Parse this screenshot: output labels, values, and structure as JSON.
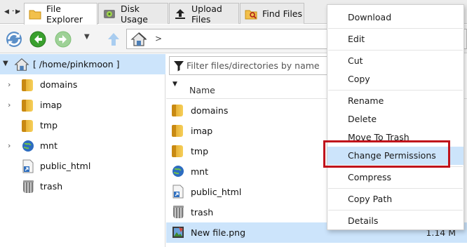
{
  "tabs": [
    {
      "label": "File Explorer",
      "icon": "folder-icon",
      "active": true
    },
    {
      "label": "Disk Usage",
      "icon": "disk-usage-icon",
      "active": false
    },
    {
      "label": "Upload Files",
      "icon": "upload-icon",
      "active": false
    },
    {
      "label": "Find Files",
      "icon": "find-files-icon",
      "active": false
    }
  ],
  "toolbar": {
    "path_separator": ">"
  },
  "tree": {
    "root_label": "[ /home/pinkmoon ]",
    "items": [
      {
        "label": "domains",
        "icon": "folder-icon",
        "expandable": true
      },
      {
        "label": "imap",
        "icon": "folder-icon",
        "expandable": true
      },
      {
        "label": "tmp",
        "icon": "folder-icon",
        "expandable": false
      },
      {
        "label": "mnt",
        "icon": "globe-icon",
        "expandable": true
      },
      {
        "label": "public_html",
        "icon": "shortcut-icon",
        "expandable": false
      },
      {
        "label": "trash",
        "icon": "trash-icon",
        "expandable": false
      }
    ]
  },
  "list": {
    "filter_placeholder": "Filter files/directories by name",
    "column_name": "Name",
    "rows": [
      {
        "label": "domains",
        "icon": "folder-icon",
        "size": ""
      },
      {
        "label": "imap",
        "icon": "folder-icon",
        "size": ""
      },
      {
        "label": "tmp",
        "icon": "folder-icon",
        "size": ""
      },
      {
        "label": "mnt",
        "icon": "globe-icon",
        "size": ""
      },
      {
        "label": "public_html",
        "icon": "shortcut-icon",
        "size": ""
      },
      {
        "label": "trash",
        "icon": "trash-icon",
        "size": ""
      },
      {
        "label": "New file.png",
        "icon": "image-file-icon",
        "size": "1.14 M",
        "selected": true
      }
    ]
  },
  "context_menu": {
    "items": [
      "Download",
      "Edit",
      "Cut",
      "Copy",
      "Rename",
      "Delete",
      "Move To Trash",
      "Change Permissions",
      "Compress",
      "Copy Path",
      "Details"
    ],
    "highlighted": "Change Permissions"
  },
  "colors": {
    "selection": "#cce4fb",
    "highlight_box": "#c0121b"
  }
}
